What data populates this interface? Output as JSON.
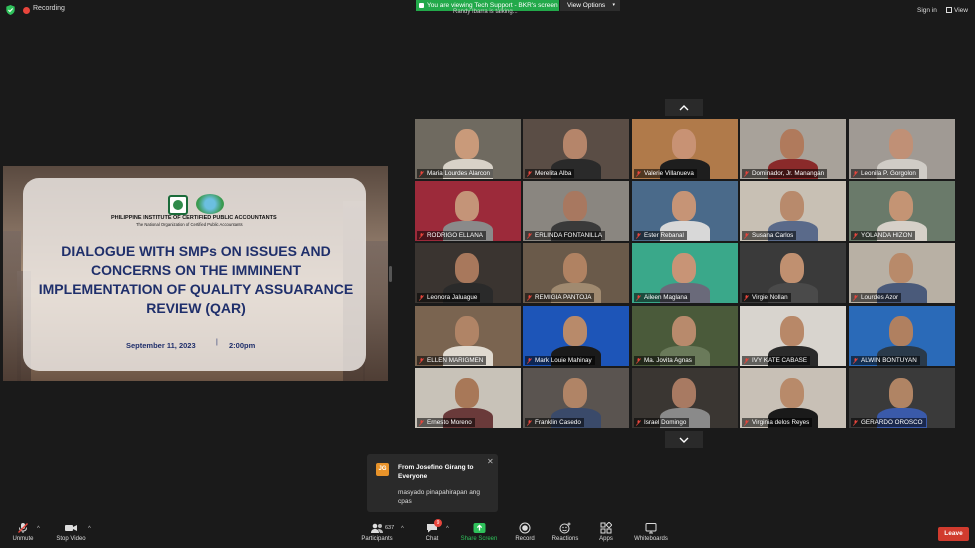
{
  "topbar": {
    "recording_label": "Recording",
    "share_banner": "You are viewing Tech Support - BKR's screen",
    "view_options_label": "View Options",
    "talking_text": "Randy Ibarra is talking...",
    "signin_label": "Sign in",
    "view_label": "View"
  },
  "presentation": {
    "org_name": "PHILIPPINE INSTITUTE OF CERTIFIED PUBLIC ACCOUNTANTS",
    "org_sub": "The National Organization of Certified Public Accountants",
    "title": "DIALOGUE WITH SMPs ON ISSUES AND CONCERNS ON THE IMMINENT IMPLEMENTATION OF QUALITY ASSUARANCE REVIEW (QAR)",
    "date": "September 11, 2023",
    "separator": "|",
    "time": "2:00pm"
  },
  "participants": [
    {
      "name": "Maria Lourdes Alarcon",
      "bg": "#6f6a60",
      "skin": "#c99a7a",
      "shirt": "#d8d2c8"
    },
    {
      "name": "Merelita Alba",
      "bg": "#5a4d45",
      "skin": "#b5856a",
      "shirt": "#2a2a2a"
    },
    {
      "name": "Valerie Villanueva",
      "bg": "#b07a4a",
      "skin": "#c89274",
      "shirt": "#1e1e1e"
    },
    {
      "name": "Dominador, Jr. Manangan",
      "bg": "#a8a29a",
      "skin": "#b07a5c",
      "shirt": "#8a2a2a"
    },
    {
      "name": "Leonila P. Gorgolon",
      "bg": "#a09a94",
      "skin": "#c09076",
      "shirt": "#d0ccc6"
    },
    {
      "name": "RODRIGO ELLANA",
      "bg": "#9c2a3a",
      "skin": "#c49478",
      "shirt": "#8a8a8a"
    },
    {
      "name": "ERLINDA FONTANILLA",
      "bg": "#8a8680",
      "skin": "#a87860",
      "shirt": "#3a3a3a"
    },
    {
      "name": "Ester Rebanal",
      "bg": "#4a6a8a",
      "skin": "#c69476",
      "shirt": "#d8d8d8"
    },
    {
      "name": "Susana Carlos",
      "bg": "#c8c0b4",
      "skin": "#b88a6c",
      "shirt": "#5a6a8a"
    },
    {
      "name": "YOLANDA HIZON",
      "bg": "#6a7a6a",
      "skin": "#c49474",
      "shirt": "#d6d0c8"
    },
    {
      "name": "Leonora Jaluague",
      "bg": "#3a3430",
      "skin": "#a8785c",
      "shirt": "#2a2a2a"
    },
    {
      "name": "REMIGIA PANTOJA",
      "bg": "#6a5a4a",
      "skin": "#b08262",
      "shirt": "#a08a70"
    },
    {
      "name": "Aileen Maglana",
      "bg": "#3aa88a",
      "skin": "#c89476",
      "shirt": "#6a6a7a"
    },
    {
      "name": "Virgie Nollan",
      "bg": "#3a3a3a",
      "skin": "#c09070",
      "shirt": "#4a4a4a"
    },
    {
      "name": "Lourdes Azor",
      "bg": "#b8b0a4",
      "skin": "#b88a6a",
      "shirt": "#4a5a7a"
    },
    {
      "name": "ELLEN MARIGMEN",
      "bg": "#7a6450",
      "skin": "#b08466",
      "shirt": "#e0dad0"
    },
    {
      "name": "Mark Louie Mahinay",
      "bg": "#1d55b8",
      "skin": "#b88a6a",
      "shirt": "#1a1a1a"
    },
    {
      "name": "Ma. Jovita Agnas",
      "bg": "#4a5a3a",
      "skin": "#b88a6c",
      "shirt": "#6a7a5a"
    },
    {
      "name": "IVY KATE CABASE",
      "bg": "#d8d4ce",
      "skin": "#b88868",
      "shirt": "#2a2a2a"
    },
    {
      "name": "ALWIN BONTUYAN",
      "bg": "#2a6ab8",
      "skin": "#b08060",
      "shirt": "#2a3a4a"
    },
    {
      "name": "Ernesto Moreno",
      "bg": "#c8c2b8",
      "skin": "#a87858",
      "shirt": "#6a3a3a"
    },
    {
      "name": "Franklin Casedo",
      "bg": "#5a5450",
      "skin": "#b08466",
      "shirt": "#3a4a6a"
    },
    {
      "name": "Israel Domingo",
      "bg": "#3a3632",
      "skin": "#a87a62",
      "shirt": "#8a8a8a"
    },
    {
      "name": "Virginia delos Reyes",
      "bg": "#c8c0b6",
      "skin": "#b88a6a",
      "shirt": "#1a1a1a"
    },
    {
      "name": "GERARDO OROSCO",
      "bg": "#3a3a3a",
      "skin": "#b08464",
      "shirt": "#3a5aaa"
    }
  ],
  "chat": {
    "avatar_initials": "JG",
    "from_line": "From Josefino Girang to Everyone",
    "message": "masyado pinapahirapan ang cpas"
  },
  "toolbar": {
    "unmute_label": "Unmute",
    "stop_video_label": "Stop Video",
    "participants_label": "Participants",
    "participants_count": "637",
    "chat_label": "Chat",
    "chat_badge": "9",
    "share_screen_label": "Share Screen",
    "record_label": "Record",
    "reactions_label": "Reactions",
    "apps_label": "Apps",
    "whiteboards_label": "Whiteboards",
    "leave_label": "Leave"
  },
  "colors": {
    "share_green": "#22a94a",
    "leave_red": "#d13b2e",
    "recording_red": "#e8453c",
    "slide_title_navy": "#1f2f6b"
  }
}
